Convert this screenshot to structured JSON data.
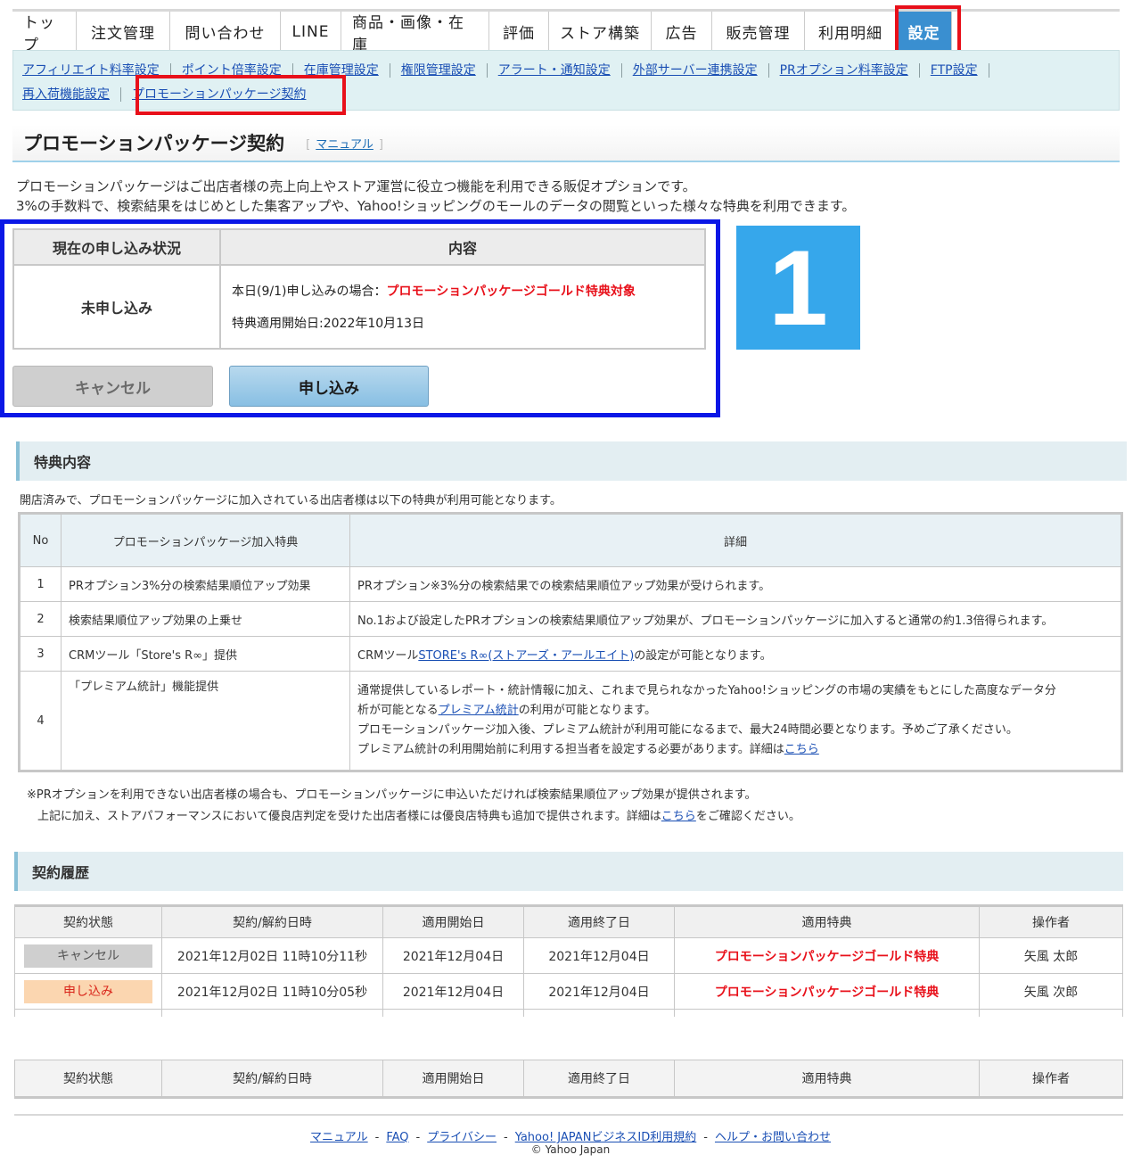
{
  "nav": {
    "tabs": [
      "トップ",
      "注文管理",
      "問い合わせ",
      "LINE",
      "商品・画像・在庫",
      "評価",
      "ストア構築",
      "広告",
      "販売管理",
      "利用明細",
      "設定"
    ]
  },
  "subnav": {
    "row1": [
      "アフィリエイト料率設定",
      "ポイント倍率設定",
      "在庫管理設定",
      "権限管理設定",
      "アラート・通知設定",
      "外部サーバー連携設定",
      "PRオプション料率設定",
      "FTP設定"
    ],
    "row2": [
      "再入荷機能設定",
      "プロモーションパッケージ契約"
    ]
  },
  "page": {
    "title": "プロモーションパッケージ契約",
    "manual_link": "マニュアル",
    "intro1": "プロモーションパッケージはご出店者様の売上向上やストア運営に役立つ機能を利用できる販促オプションです。",
    "intro2": "3%の手数料で、検索結果をはじめとした集客アップや、Yahoo!ショッピングのモールのデータの閲覧といった様々な特典を利用できます。"
  },
  "status": {
    "header_status": "現在の申し込み状況",
    "header_content": "内容",
    "value": "未申し込み",
    "line1_prefix": "本日(9/1)申し込みの場合：",
    "line1_highlight": "プロモーションパッケージゴールド特典対象",
    "line2": "特典適用開始日:2022年10月13日",
    "cancel_button": "キャンセル",
    "apply_button": "申し込み",
    "step_number": "1"
  },
  "benefits": {
    "section_title": "特典内容",
    "intro": "開店済みで、プロモーションパッケージに加入されている出店者様は以下の特典が利用可能となります。",
    "headers": [
      "No",
      "プロモーションパッケージ加入特典",
      "詳細"
    ],
    "rows": [
      {
        "no": "1",
        "name": "PRオプション3%分の検索結果順位アップ効果",
        "detail": "PRオプション※3%分の検索結果での検索結果順位アップ効果が受けられます。"
      },
      {
        "no": "2",
        "name": "検索結果順位アップ効果の上乗せ",
        "detail": "No.1および設定したPRオプションの検索結果順位アップ効果が、プロモーションパッケージに加入すると通常の約1.3倍得られます。"
      },
      {
        "no": "3",
        "name": "CRMツール「Store's R∞」提供",
        "detail_prefix": "CRMツール",
        "detail_link": "STORE's R∞(ストアーズ・アールエイト)",
        "detail_suffix": "の設定が可能となります。"
      },
      {
        "no": "4",
        "name": "「プレミアム統計」機能提供",
        "detail_l1": "通常提供しているレポート・統計情報に加え、これまで見られなかったYahoo!ショッピングの市場の実績をもとにした高度なデータ分",
        "detail_l2_prefix": "析が可能となる",
        "detail_l2_link": "プレミアム統計",
        "detail_l2_suffix": "の利用が可能となります。",
        "detail_l3": "プロモーションパッケージ加入後、プレミアム統計が利用可能になるまで、最大24時間必要となります。予めご了承ください。",
        "detail_l4_prefix": "プレミアム統計の利用開始前に利用する担当者を設定する必要があります。詳細は",
        "detail_l4_link": "こちら"
      }
    ],
    "footnote1": "※PRオプションを利用できない出店者様の場合も、プロモーションパッケージに申込いただければ検索結果順位アップ効果が提供されます。",
    "footnote2_prefix": "上記に加え、ストアパフォーマンスにおいて優良店判定を受けた出店者様には優良店特典も追加で提供されます。詳細は",
    "footnote2_link": "こちら",
    "footnote2_suffix": "をご確認ください。"
  },
  "history": {
    "section_title": "契約履歴",
    "headers": [
      "契約状態",
      "契約/解約日時",
      "適用開始日",
      "適用終了日",
      "適用特典",
      "操作者"
    ],
    "rows": [
      {
        "status": "キャンセル",
        "datetime": "2021年12月02日 11時10分11秒",
        "start": "2021年12月04日",
        "end": "2021年12月04日",
        "benefit": "プロモーションパッケージゴールド特典",
        "operator": "矢風 太郎"
      },
      {
        "status": "申し込み",
        "datetime": "2021年12月02日 11時10分05秒",
        "start": "2021年12月04日",
        "end": "2021年12月04日",
        "benefit": "プロモーションパッケージゴールド特典",
        "operator": "矢風 次郎"
      }
    ]
  },
  "footer": {
    "links": [
      "マニュアル",
      "FAQ",
      "プライバシー",
      "Yahoo! JAPANビジネスID利用規約",
      "ヘルプ・お問い合わせ"
    ],
    "separator": "-",
    "copyright": "© Yahoo Japan"
  }
}
